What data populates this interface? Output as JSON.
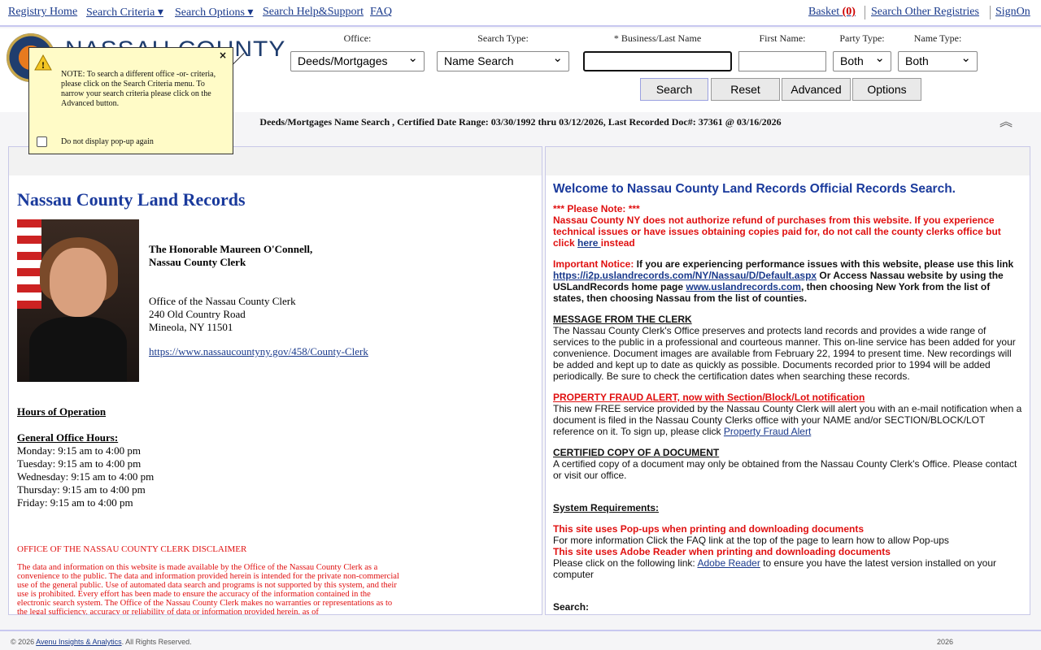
{
  "nav": {
    "registry_home": "Registry Home",
    "search_criteria": "Search Criteria ▾",
    "search_options": "Search Options ▾",
    "search_help": "Search Help&Support",
    "faq": "FAQ",
    "basket": "Basket",
    "basket_count": "(0)",
    "search_other": "Search Other Registries",
    "signon": "SignOn"
  },
  "header": {
    "logo_text": "NASSAU COUNTY"
  },
  "form": {
    "office_label": "Office:",
    "office_value": "Deeds/Mortgages",
    "search_type_label": "Search Type:",
    "search_type_value": "Name Search",
    "last_name_label": "* Business/Last Name",
    "last_name_value": "",
    "first_name_label": "First Name:",
    "first_name_value": "",
    "party_type_label": "Party Type:",
    "party_type_value": "Both",
    "name_type_label": "Name Type:",
    "name_type_value": "Both",
    "search": "Search",
    "reset": "Reset",
    "advanced": "Advanced",
    "options": "Options"
  },
  "infobar": "Deeds/Mortgages Name Search , Certified Date Range: 03/30/1992 thru 03/12/2026, Last Recorded Doc#: 37361 @ 03/16/2026",
  "popup": {
    "note": "NOTE: To search a different office -or- criteria, please click on the Search Criteria menu. To narrow your search criteria please click on the Advanced button.",
    "checkbox_label": "Do not display pop-up again",
    "close": "×"
  },
  "left": {
    "title": "Nassau County Land Records",
    "clerk_name": "The Honorable Maureen O'Connell,",
    "clerk_title": "Nassau County Clerk",
    "office": "Office of the Nassau County Clerk",
    "address1": "240 Old Country Road",
    "address2": "Mineola, NY 11501",
    "link": "https://www.nassaucountyny.gov/458/County-Clerk",
    "hours_heading": "Hours of Operation",
    "general_hours": "General Office Hours:",
    "hours": [
      "Monday: 9:15 am to 4:00 pm",
      "Tuesday: 9:15 am to 4:00 pm",
      "Wednesday: 9:15 am to 4:00 pm",
      "Thursday: 9:15 am to 4:00 pm",
      "Friday: 9:15 am to 4:00 pm"
    ],
    "disclaimer_title": "OFFICE OF THE NASSAU COUNTY CLERK DISCLAIMER",
    "disclaimer": "The data and information on this website is made available by the Office of the Nassau County Clerk as a convenience to the public. The data and information provided herein is intended for the private non-commercial use of the general public. Use of automated data search and programs is not supported by this system, and their use is prohibited. Every effort has been made to ensure the accuracy of the information contained in the electronic search system. The Office of the Nassau County Clerk makes no warranties or representations as to the legal sufficiency, accuracy or reliability of data or information provided herein, as of"
  },
  "right": {
    "title": "Welcome to Nassau County Land Records Official Records Search.",
    "please_note": "*** Please Note: ***",
    "refund_note": "Nassau County NY does not authorize refund of purchases from this website. If you experience technical issues or have issues obtaining copies paid for, do not call the county clerks office but click",
    "here": "here ",
    "instead": "instead",
    "important_label": "Important Notice:",
    "important_text": " If you are experiencing performance issues with this website, please use this link ",
    "i2p_link": "https://i2p.uslandrecords.com/NY/Nassau/D/Default.aspx",
    "important_text2": " Or Access Nassau website by using the USLandRecords home page ",
    "usl_link": "www.uslandrecords.com",
    "important_text3": ", then choosing New York from the list of states, then choosing Nassau from the list of counties.",
    "msg_heading": "MESSAGE FROM THE CLERK",
    "msg_text": "The Nassau County Clerk's Office preserves and protects land records and provides a wide range of services to the public in a professional and courteous manner. This on-line service has been added for your convenience. Document images are available from February 22, 1994 to present time. New recordings will be added and kept up to date as quickly as possible. Documents recorded prior to 1994 will be added periodically. Be sure to check the certification dates when searching these records.",
    "fraud_heading": "PROPERTY FRAUD ALERT, now with Section/Block/Lot notification",
    "fraud_text": "This new FREE service provided by the Nassau County Clerk will alert you with an e-mail notification when a document is filed in the Nassau County Clerks office with your NAME and/or SECTION/BLOCK/LOT reference on it.  To sign up, please click ",
    "fraud_link": "Property Fraud Alert",
    "cert_heading": "CERTIFIED COPY OF A DOCUMENT",
    "cert_text": "A certified copy of a document may only be obtained from the Nassau County Clerk's Office. Please contact or visit our office.",
    "sys_heading": "System Requirements:",
    "popups_red": "This site uses Pop-ups when printing and downloading documents",
    "popups_text": "For more information Click the FAQ link at the top of the page to learn how to allow Pop-ups",
    "adobe_red": "This site uses Adobe Reader when printing and downloading documents",
    "adobe_text1": "Please click on the following link: ",
    "adobe_link": "Adobe Reader",
    "adobe_text2": " to ensure you have the latest version installed on your computer",
    "search_heading": "Search:"
  },
  "footer": {
    "copyright": "© 2026 ",
    "company": "Avenu Insights & Analytics",
    "rights": ". All Rights Reserved.",
    "year": "2026"
  }
}
